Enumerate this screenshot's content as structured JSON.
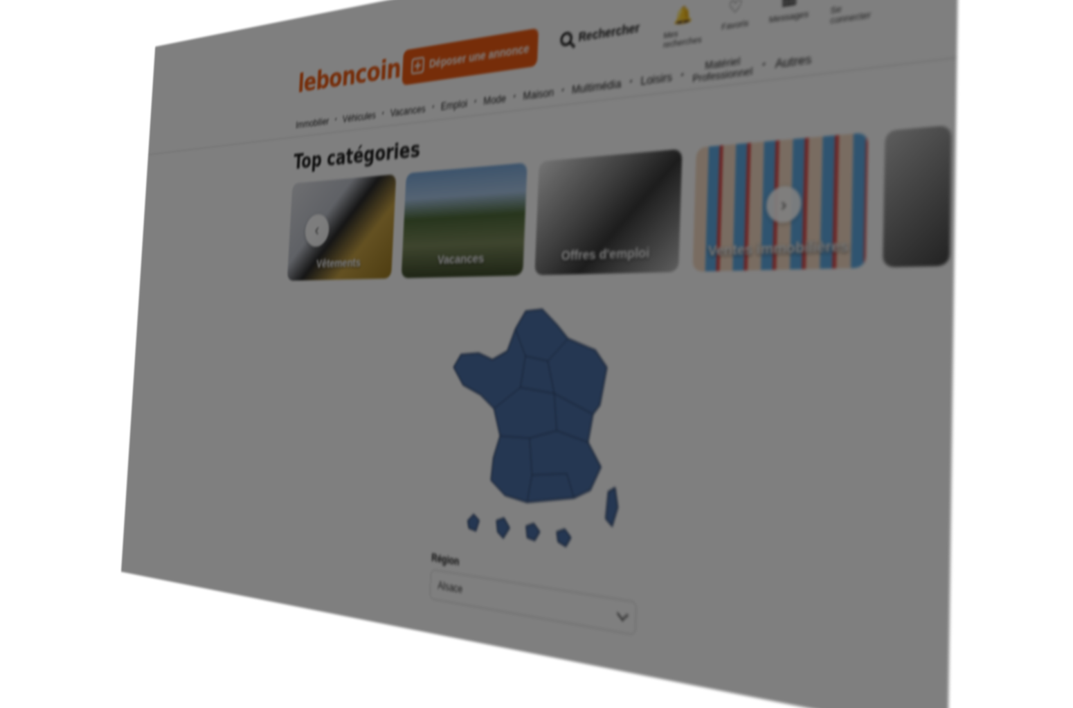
{
  "header": {
    "logo": "leboncoin",
    "post_button_label": "Déposer une annonce",
    "search_label": "Rechercher",
    "quick_links": [
      {
        "label": "Mes recherches",
        "icon": "bell-icon"
      },
      {
        "label": "Favoris",
        "icon": "heart-icon"
      },
      {
        "label": "Messages",
        "icon": "message-icon"
      },
      {
        "label": "Se connecter",
        "icon": "user-icon"
      }
    ]
  },
  "nav": {
    "items": [
      "Immobilier",
      "Véhicules",
      "Vacances",
      "Emploi",
      "Mode",
      "Maison",
      "Multimédia",
      "Loisirs",
      "Matériel",
      "Professionnel",
      "Autres"
    ]
  },
  "top_categories": {
    "title": "Top catégories",
    "cards": [
      {
        "label": "Vêtements"
      },
      {
        "label": "Vacances"
      },
      {
        "label": "Offres d'emploi"
      },
      {
        "label": "Ventes immobilières"
      }
    ]
  },
  "map": {
    "fill_color": "#4a6fa5"
  },
  "region": {
    "label": "Région",
    "selected": "Alsace"
  },
  "colors": {
    "brand": "#ec5a13",
    "overlay": "rgba(0,0,0,0.5)"
  }
}
